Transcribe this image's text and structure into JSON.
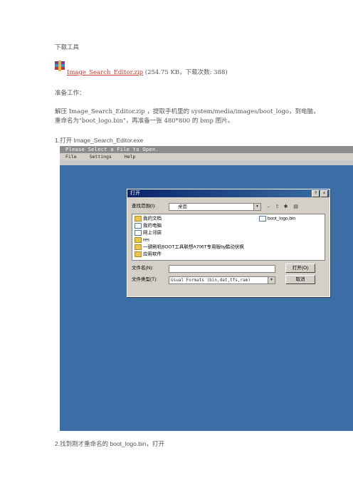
{
  "heading": "下载工具",
  "attachment": {
    "icon": "winrar-archive-icon",
    "filename": "Image_Search_Editor.zip",
    "meta": "(254.75 KB，下载次数: 388)"
  },
  "prep_title": "准备工作：",
  "prep_line1": "解压 Image_Search_Editor.zip ，提取手机里的 system/media/images/boot_logo，到电脑，",
  "prep_line2": "重命名为\"boot_logo.bin\"，再准备一张 480*800 的 bmp 图片。",
  "step1": "1.打开 Image_Search_Editor.exe",
  "step2": "2.找到刚才重命名的  boot_logo.bin，打开",
  "screenshot": {
    "window_title": "Please Select a File to Open.",
    "menu": [
      "File",
      "Settings",
      "Help"
    ],
    "dialog": {
      "title": "打开",
      "help_btn": "?",
      "close_btn": "×",
      "lookin_label": "查找范围(I):",
      "lookin_value": "桌面",
      "files_left": [
        "我的文档",
        "我的电脑",
        "网上邻居",
        "res",
        "一键刷机BOOT工具联想A706T专用版by酷动伏枫",
        "应用软件"
      ],
      "files_right": [
        "boot_logo.bin"
      ],
      "filename_label": "文件名(N):",
      "filename_value": "",
      "filetype_label": "文件类型(T):",
      "filetype_value": "Usual Formats (bin,dat,tfs,ram)",
      "open_btn": "打开(O)",
      "cancel_btn": "取消"
    }
  }
}
